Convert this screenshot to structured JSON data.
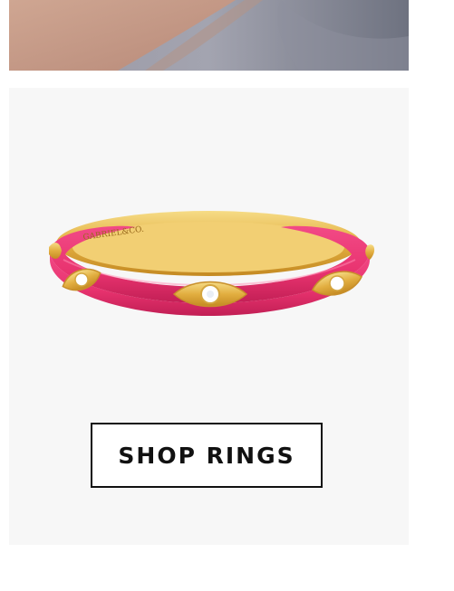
{
  "hero_image": {
    "icon": "model-hand-photo"
  },
  "product": {
    "image_icon": "pink-enamel-ring",
    "engraving": "GABRIEL & CO.",
    "colors": {
      "enamel": "#e8336f",
      "gold": "#e9b94a"
    }
  },
  "cta": {
    "label": "SHOP RINGS"
  }
}
